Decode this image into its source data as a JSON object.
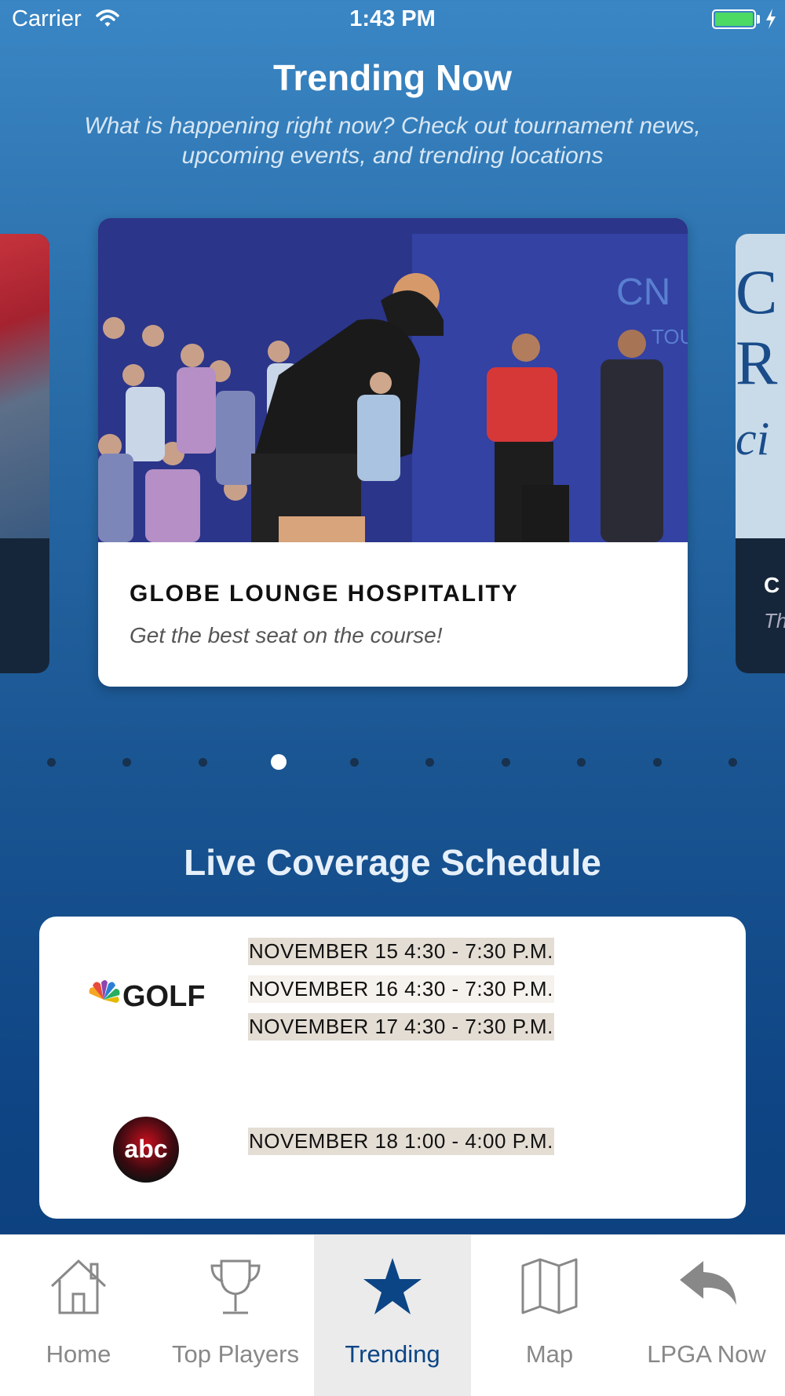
{
  "status_bar": {
    "carrier": "Carrier",
    "time": "1:43 PM"
  },
  "header": {
    "title": "Trending Now",
    "subtitle": "What is happening right now? Check out tournament news, upcoming events, and trending locations"
  },
  "carousel": {
    "current_card": {
      "title": "GLOBE LOUNGE HOSPITALITY",
      "description": "Get the best seat on the course!"
    },
    "next_card": {
      "title_visible": "C",
      "description_visible": "Th"
    },
    "page_count": 10,
    "active_page": 4
  },
  "schedule": {
    "title": "Live Coverage Schedule",
    "networks": [
      {
        "logo": "GOLF",
        "icon": "nbc-peacock-icon",
        "slots": [
          "NOVEMBER 15 4:30 - 7:30 P.M.",
          "NOVEMBER 16 4:30 - 7:30 P.M.",
          "NOVEMBER 17 4:30 - 7:30 P.M."
        ]
      },
      {
        "logo": "abc",
        "icon": "abc-logo-icon",
        "slots": [
          "NOVEMBER 18 1:00 - 4:00 P.M."
        ]
      }
    ]
  },
  "tabbar": {
    "items": [
      {
        "label": "Home",
        "icon": "home-icon"
      },
      {
        "label": "Top Players",
        "icon": "trophy-icon"
      },
      {
        "label": "Trending",
        "icon": "star-icon",
        "active": true
      },
      {
        "label": "Map",
        "icon": "map-icon"
      },
      {
        "label": "LPGA Now",
        "icon": "reply-arrow-icon"
      }
    ]
  },
  "colors": {
    "accent": "#0b4585",
    "battery": "#4cd964",
    "background_top": "#3a86c4",
    "background_bottom": "#0b3d7a"
  }
}
